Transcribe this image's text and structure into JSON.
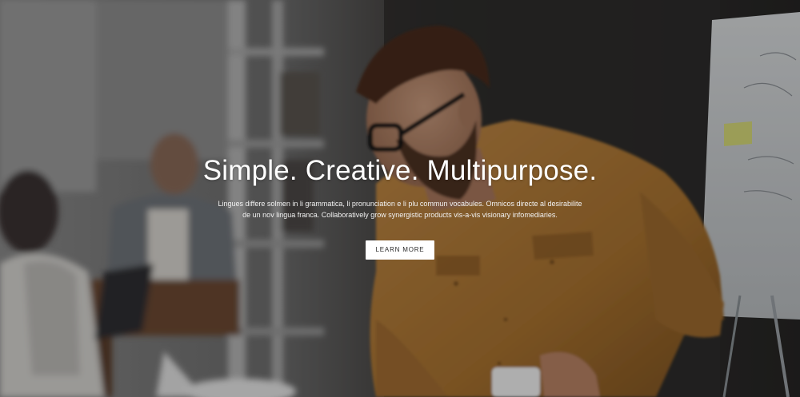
{
  "hero": {
    "title": "Simple. Creative. Multipurpose.",
    "description_line_1": "Lingues differe solmen in li grammatica, li pronunciation e li plu commun vocabules. Omnicos directe al desirabilite",
    "description_line_2": "de un nov lingua franca. Collaboratively grow synergistic products vis-a-vis visionary infomediaries.",
    "cta_label": "LEARN MORE"
  },
  "colors": {
    "title_text": "#ffffff",
    "button_background": "#ffffff",
    "button_text": "#2a2a2a",
    "shirt": "#b07a3c",
    "background_dark": "#2b2b2b"
  }
}
